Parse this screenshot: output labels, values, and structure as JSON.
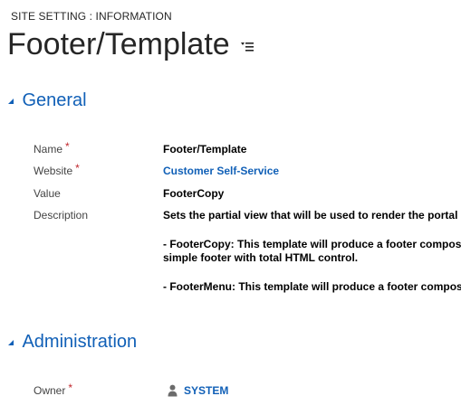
{
  "header": {
    "entity_type": "SITE SETTING : INFORMATION",
    "record_title": "Footer/Template",
    "title_menu_icon": "list-menu-icon"
  },
  "sections": {
    "general": {
      "title": "General",
      "collapse_icon": "caret-down-icon",
      "fields": {
        "name": {
          "label": "Name",
          "required": "*",
          "value": "Footer/Template"
        },
        "website": {
          "label": "Website",
          "required": "*",
          "value": "Customer Self-Service"
        },
        "value": {
          "label": "Value",
          "value": "FooterCopy"
        },
        "description": {
          "label": "Description",
          "lines": [
            "Sets the partial view that will be used to render the portal",
            "- FooterCopy: This template will produce a footer composed",
            "simple footer with total HTML control.",
            "- FooterMenu: This template will produce a footer composed"
          ]
        }
      }
    },
    "administration": {
      "title": "Administration",
      "collapse_icon": "caret-down-icon",
      "fields": {
        "owner": {
          "label": "Owner",
          "required": "*",
          "value": "SYSTEM",
          "icon": "user-icon"
        }
      }
    }
  },
  "colors": {
    "accent_blue": "#1160b7",
    "required_red": "#c0272d",
    "text_dark": "#262626",
    "label_gray": "#444444"
  }
}
